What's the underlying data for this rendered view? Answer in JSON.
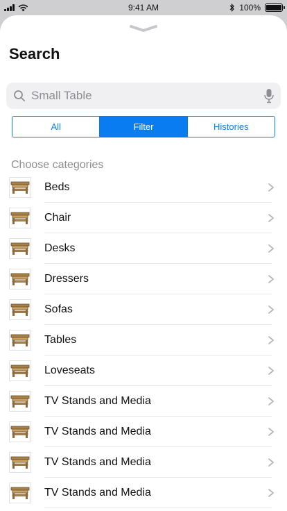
{
  "status_bar": {
    "time": "9:41 AM",
    "battery": "100%",
    "icons": [
      "signal-icon",
      "wifi-icon",
      "bluetooth-icon",
      "battery-icon"
    ]
  },
  "header": {
    "title": "Search"
  },
  "search": {
    "placeholder": "Small Table",
    "icons": [
      "search-icon",
      "microphone-icon"
    ]
  },
  "segments": {
    "items": [
      "All",
      "Filter",
      "Histories"
    ],
    "selected": "Filter"
  },
  "categories": {
    "header": "Choose categories",
    "items": [
      "Beds",
      "Chair",
      "Desks",
      "Dressers",
      "Sofas",
      "Tables",
      "Loveseats",
      "TV Stands and Media",
      "TV Stands and Media",
      "TV Stands and Media",
      "TV Stands and Media"
    ]
  },
  "colors": {
    "accent": "#0a7cf2",
    "thumb_wood": "#a8824a"
  }
}
